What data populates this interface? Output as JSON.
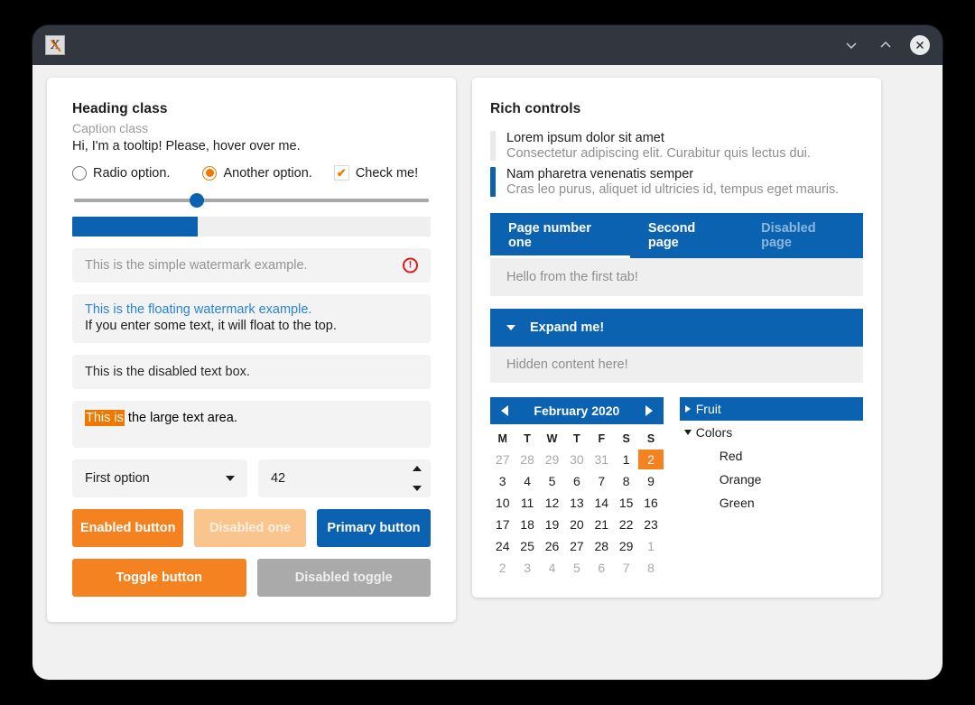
{
  "window": {
    "app_icon": "x-logo-icon",
    "minimize_icon": "chevron-down-icon",
    "maximize_icon": "chevron-up-icon",
    "close_icon": "close-x-icon"
  },
  "left_panel": {
    "heading": "Heading class",
    "caption": "Caption class",
    "tooltip_text": "Hi, I'm a tooltip! Please, hover over me.",
    "radio1_label": "Radio option.",
    "radio2_label": "Another option.",
    "checkbox_label": "Check me!",
    "checkbox_glyph": "✔",
    "slider_value": "35",
    "progress_value": "35",
    "watermark_placeholder": "This is the simple watermark example.",
    "error_glyph": "!",
    "floating_label": "This is the floating watermark example.",
    "floating_value": "If you enter some text, it will float to the top.",
    "disabled_text": "This is the disabled text box.",
    "textarea_selected": "This is",
    "textarea_rest": " the large text area.",
    "combo_value": "First option",
    "spinner_value": "42",
    "btn_enabled": "Enabled button",
    "btn_disabled": "Disabled one",
    "btn_primary": "Primary button",
    "btn_toggle": "Toggle button",
    "btn_toggle_disabled": "Disabled toggle"
  },
  "right_panel": {
    "heading": "Rich controls",
    "list": [
      {
        "title": "Lorem ipsum dolor sit amet",
        "subtitle": "Consectetur adipiscing elit. Curabitur quis lectus dui.",
        "accent": "grey"
      },
      {
        "title": "Nam pharetra venenatis semper",
        "subtitle": "Cras leo purus, aliquet id ultricies id, tempus eget mauris.",
        "accent": "blue"
      }
    ],
    "tabs": [
      {
        "label": "Page number one",
        "state": "active"
      },
      {
        "label": "Second page",
        "state": "normal"
      },
      {
        "label": "Disabled page",
        "state": "disabled"
      }
    ],
    "tab_content": "Hello from the first tab!",
    "expander_label": "Expand me!",
    "expander_content": "Hidden content here!",
    "calendar": {
      "title": "February 2020",
      "prev_icon": "chevron-left-icon",
      "next_icon": "chevron-right-icon",
      "day_headers": [
        "M",
        "T",
        "W",
        "T",
        "F",
        "S",
        "S"
      ],
      "weeks": [
        [
          {
            "n": "27",
            "state": "muted"
          },
          {
            "n": "28",
            "state": "muted"
          },
          {
            "n": "29",
            "state": "muted"
          },
          {
            "n": "30",
            "state": "muted"
          },
          {
            "n": "31",
            "state": "muted"
          },
          {
            "n": "1",
            "state": "normal"
          },
          {
            "n": "2",
            "state": "today"
          }
        ],
        [
          {
            "n": "3",
            "state": "normal"
          },
          {
            "n": "4",
            "state": "normal"
          },
          {
            "n": "5",
            "state": "normal"
          },
          {
            "n": "6",
            "state": "normal"
          },
          {
            "n": "7",
            "state": "normal"
          },
          {
            "n": "8",
            "state": "normal"
          },
          {
            "n": "9",
            "state": "normal"
          }
        ],
        [
          {
            "n": "10",
            "state": "normal"
          },
          {
            "n": "11",
            "state": "normal"
          },
          {
            "n": "12",
            "state": "normal"
          },
          {
            "n": "13",
            "state": "normal"
          },
          {
            "n": "14",
            "state": "normal"
          },
          {
            "n": "15",
            "state": "normal"
          },
          {
            "n": "16",
            "state": "normal"
          }
        ],
        [
          {
            "n": "17",
            "state": "normal"
          },
          {
            "n": "18",
            "state": "normal"
          },
          {
            "n": "19",
            "state": "normal"
          },
          {
            "n": "20",
            "state": "normal"
          },
          {
            "n": "21",
            "state": "normal"
          },
          {
            "n": "22",
            "state": "normal"
          },
          {
            "n": "23",
            "state": "normal"
          }
        ],
        [
          {
            "n": "24",
            "state": "normal"
          },
          {
            "n": "25",
            "state": "normal"
          },
          {
            "n": "26",
            "state": "normal"
          },
          {
            "n": "27",
            "state": "normal"
          },
          {
            "n": "28",
            "state": "normal"
          },
          {
            "n": "29",
            "state": "normal"
          },
          {
            "n": "1",
            "state": "muted"
          }
        ],
        [
          {
            "n": "2",
            "state": "muted"
          },
          {
            "n": "3",
            "state": "muted"
          },
          {
            "n": "4",
            "state": "muted"
          },
          {
            "n": "5",
            "state": "muted"
          },
          {
            "n": "6",
            "state": "muted"
          },
          {
            "n": "7",
            "state": "muted"
          },
          {
            "n": "8",
            "state": "muted"
          }
        ]
      ]
    },
    "tree": [
      {
        "label": "Fruit",
        "level": 0,
        "caret": "right",
        "selected": true
      },
      {
        "label": "Colors",
        "level": 0,
        "caret": "down",
        "selected": false
      },
      {
        "label": "Red",
        "level": 1,
        "caret": "none",
        "selected": false
      },
      {
        "label": "Orange",
        "level": 1,
        "caret": "none",
        "selected": false
      },
      {
        "label": "Green",
        "level": 1,
        "caret": "none",
        "selected": false
      }
    ]
  },
  "colors": {
    "accent_blue": "#0a62b0",
    "accent_orange": "#f58220",
    "error_red": "#e01b1b",
    "link_blue": "#2883d8",
    "muted_grey": "#8e8e8e",
    "titlebar": "#32363e",
    "client_bg": "#f1f1f1"
  }
}
